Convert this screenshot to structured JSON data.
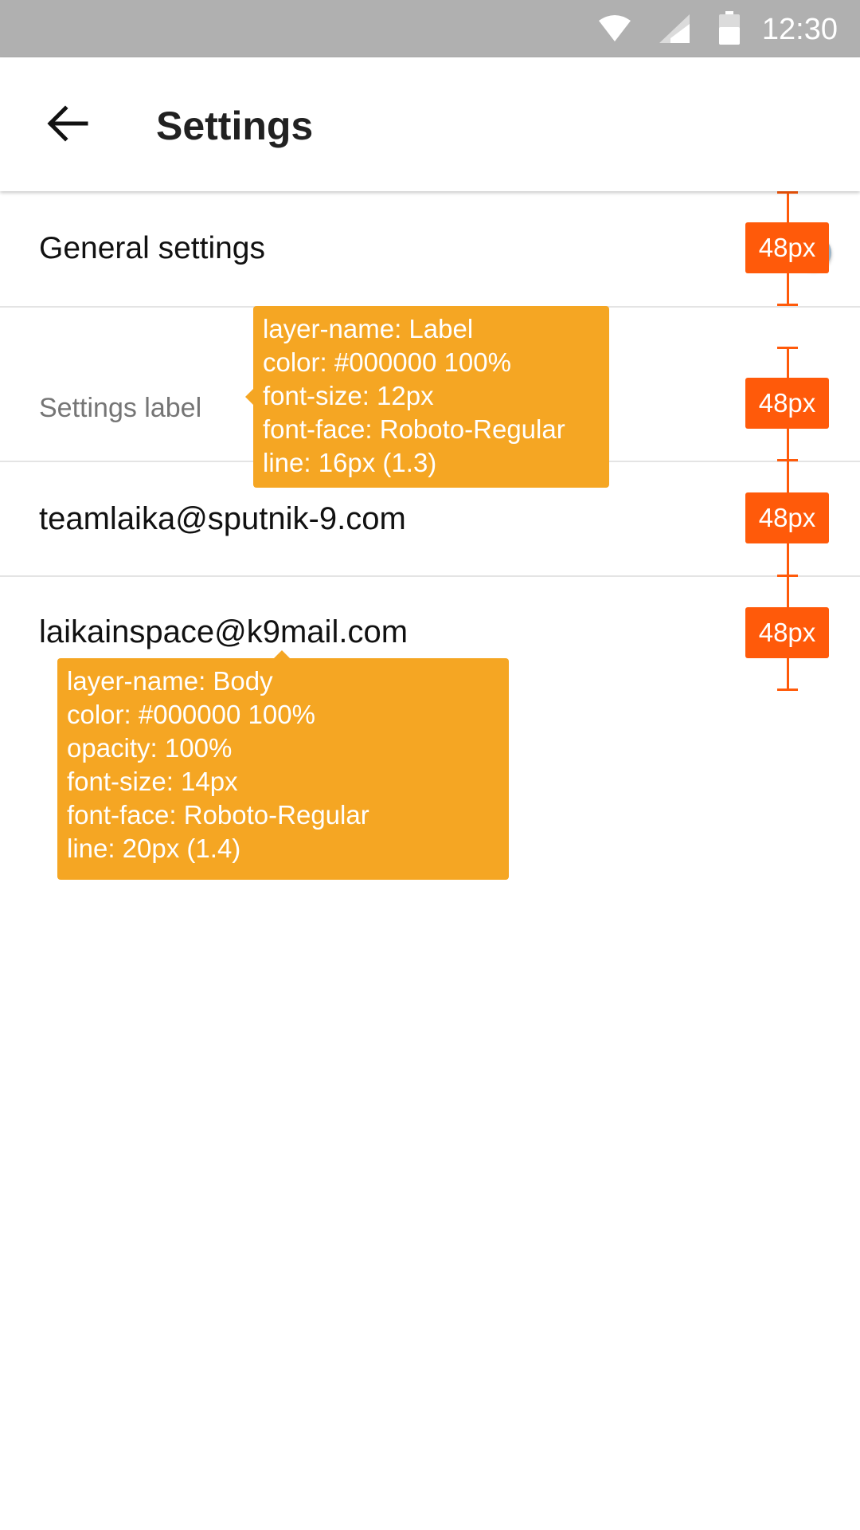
{
  "status_bar": {
    "time": "12:30",
    "icons": [
      "wifi-icon",
      "cell-signal-icon",
      "battery-icon"
    ]
  },
  "app_bar": {
    "title": "Settings",
    "back_icon": "arrow-back-icon"
  },
  "rows": [
    {
      "text": "General settings"
    },
    {
      "text": "Settings label"
    },
    {
      "text": "teamlaika@sputnik-9.com"
    },
    {
      "text": "laikainspace@k9mail.com"
    }
  ],
  "measurements": [
    "48px",
    "48px",
    "48px",
    "48px"
  ],
  "spec_label": {
    "lines": [
      "layer-name: Label",
      "color: #000000 100%",
      "font-size: 12px",
      "font-face: Roboto-Regular",
      "line: 16px (1.3)"
    ]
  },
  "spec_body": {
    "lines": [
      "layer-name: Body",
      "color: #000000 100%",
      "opacity: 100%",
      "font-size: 14px",
      "font-face: Roboto-Regular",
      "line: 20px (1.4)"
    ]
  },
  "colors": {
    "status_bar": "#b0b0b0",
    "redline": "#ff5a0a",
    "spec_tooltip": "#f5a623"
  }
}
